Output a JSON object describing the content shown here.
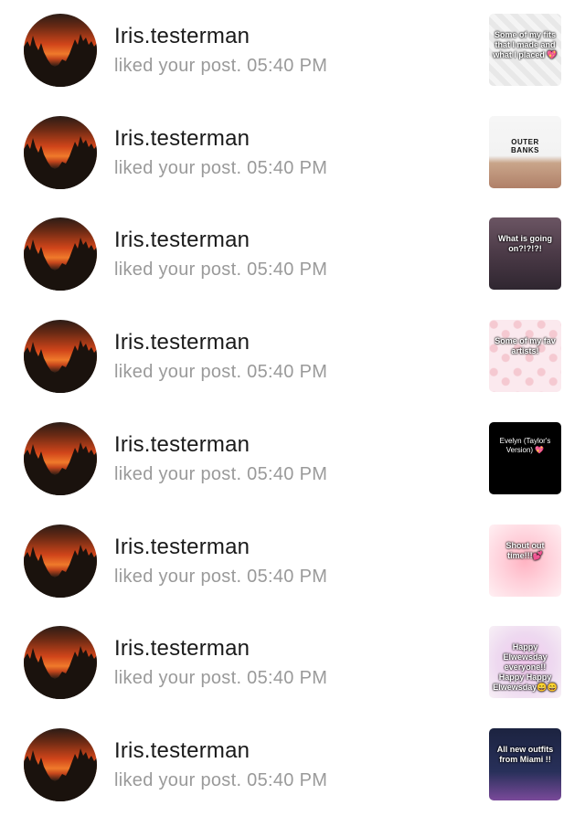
{
  "notifications": [
    {
      "username": "Iris.testerman",
      "activity": "liked your post. 05:40 PM",
      "thumbnail": {
        "caption": "Some of my fits that I made and what I placed 💖",
        "style": "t0"
      }
    },
    {
      "username": "Iris.testerman",
      "activity": "liked your post. 05:40 PM",
      "thumbnail": {
        "caption": "OUTER BANKS",
        "style": "t1"
      }
    },
    {
      "username": "Iris.testerman",
      "activity": "liked your post. 05:40 PM",
      "thumbnail": {
        "caption": "What is going on?!?!?!",
        "style": "t2"
      }
    },
    {
      "username": "Iris.testerman",
      "activity": "liked your post. 05:40 PM",
      "thumbnail": {
        "caption": "Some of my fav artists!",
        "style": "t3"
      }
    },
    {
      "username": "Iris.testerman",
      "activity": "liked your post. 05:40 PM",
      "thumbnail": {
        "caption": "Evelyn (Taylor's Version) 💖",
        "style": "t4"
      }
    },
    {
      "username": "Iris.testerman",
      "activity": "liked your post. 05:40 PM",
      "thumbnail": {
        "caption": "Shout out time!!!💕",
        "style": "t5"
      }
    },
    {
      "username": "Iris.testerman",
      "activity": "liked your post. 05:40 PM",
      "thumbnail": {
        "caption": "Happy Elwewsday everyone!! Happy Happy Elwewsday😄😄",
        "style": "t6"
      }
    },
    {
      "username": "Iris.testerman",
      "activity": "liked your post. 05:40 PM",
      "thumbnail": {
        "caption": "All new outfits from Miami !!",
        "style": "t7"
      }
    }
  ]
}
